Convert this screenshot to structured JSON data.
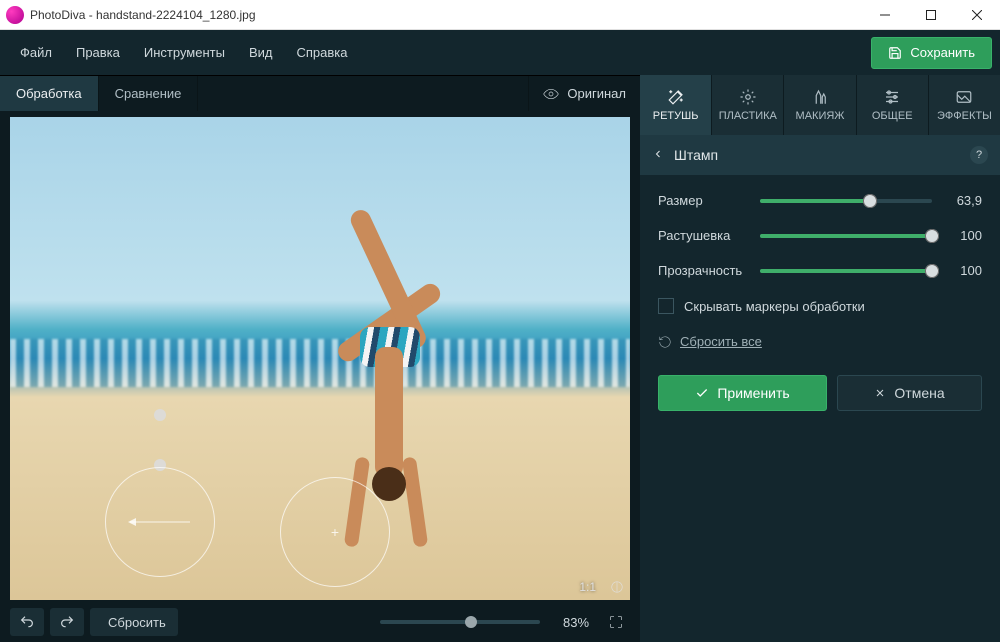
{
  "window": {
    "app_name": "PhotoDiva",
    "file_name": "handstand-2224104_1280.jpg",
    "title": "PhotoDiva - handstand-2224104_1280.jpg"
  },
  "menu": {
    "file": "Файл",
    "edit": "Правка",
    "tools": "Инструменты",
    "view": "Вид",
    "help": "Справка"
  },
  "save_button": "Сохранить",
  "mode_tabs": {
    "processing": "Обработка",
    "compare": "Сравнение",
    "active": "processing"
  },
  "original_button": "Оригинал",
  "tool_tabs": {
    "retouch": "РЕТУШЬ",
    "plastic": "ПЛАСТИКА",
    "makeup": "МАКИЯЖ",
    "general": "ОБЩЕЕ",
    "effects": "ЭФФЕКТЫ",
    "active": "retouch"
  },
  "panel": {
    "title": "Штамп",
    "help": "?",
    "sliders": {
      "size": {
        "label": "Размер",
        "value": "63,9",
        "percent": 63.9
      },
      "feather": {
        "label": "Растушевка",
        "value": "100",
        "percent": 100
      },
      "opacity": {
        "label": "Прозрачность",
        "value": "100",
        "percent": 100
      }
    },
    "hide_markers": {
      "label": "Скрывать маркеры обработки",
      "checked": false
    },
    "reset_all": "Сбросить все",
    "apply": "Применить",
    "cancel": "Отмена"
  },
  "canvas": {
    "ratio_label": "1:1",
    "before_after_icon": "before-after-icon"
  },
  "bottom": {
    "reset": "Сбросить",
    "zoom_percent": 83,
    "zoom_label": "83%"
  }
}
